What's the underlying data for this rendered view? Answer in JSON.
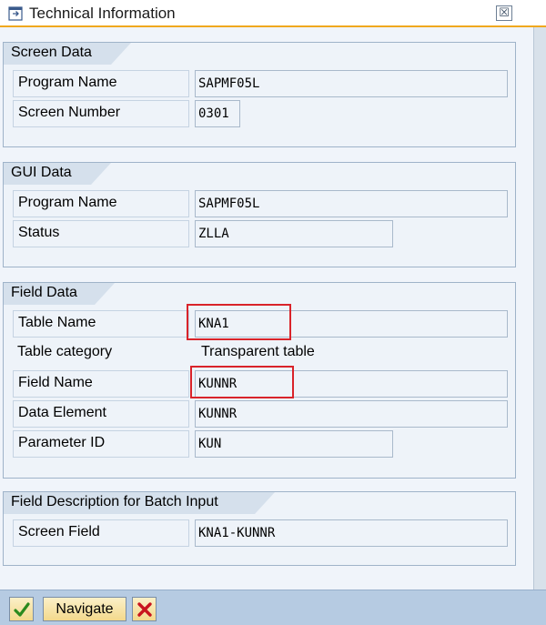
{
  "window": {
    "title": "Technical Information",
    "title_icon": "info-window-icon",
    "close_label": "☒"
  },
  "screen_data": {
    "header": "Screen Data",
    "program_name_label": "Program Name",
    "program_name_value": "SAPMF05L",
    "screen_number_label": "Screen Number",
    "screen_number_value": "0301"
  },
  "gui_data": {
    "header": "GUI Data",
    "program_name_label": "Program Name",
    "program_name_value": "SAPMF05L",
    "status_label": "Status",
    "status_value": "ZLLA"
  },
  "field_data": {
    "header": "Field Data",
    "table_name_label": "Table Name",
    "table_name_value": "KNA1",
    "table_category_label": "Table category",
    "table_category_value": "Transparent table",
    "field_name_label": "Field Name",
    "field_name_value": "KUNNR",
    "data_element_label": "Data Element",
    "data_element_value": "KUNNR",
    "parameter_id_label": "Parameter ID",
    "parameter_id_value": "KUN"
  },
  "batch_input": {
    "header": "Field Description for Batch Input",
    "screen_field_label": "Screen Field",
    "screen_field_value": "KNA1-KUNNR"
  },
  "footer": {
    "confirm_icon": "checkmark-icon",
    "navigate_label": "Navigate",
    "cancel_icon": "cancel-x-icon"
  },
  "colors": {
    "highlight": "#d9232a",
    "title_underline": "#f0a81e",
    "footer_bg": "#b6cbe2"
  }
}
